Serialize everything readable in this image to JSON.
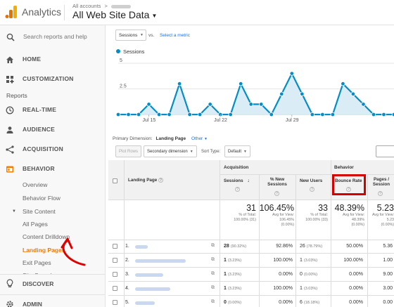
{
  "header": {
    "app_name": "Analytics",
    "crumb_prefix": "All accounts",
    "crumb_sep": ">",
    "view_name": "All Web Site Data"
  },
  "sidebar": {
    "search_placeholder": "Search reports and help",
    "home": "HOME",
    "customization": "CUSTOMIZATION",
    "reports_label": "Reports",
    "realtime": "REAL-TIME",
    "audience": "AUDIENCE",
    "acquisition": "ACQUISITION",
    "behavior": "BEHAVIOR",
    "behavior_items": {
      "overview": "Overview",
      "behavior_flow": "Behavior Flow",
      "site_content": "Site Content",
      "all_pages": "All Pages",
      "content_drilldown": "Content Drilldown",
      "landing_pages": "Landing Pages",
      "exit_pages": "Exit Pages",
      "site_speed": "Site Speed"
    },
    "discover": "DISCOVER",
    "admin": "ADMIN",
    "accent_color": "#f57c00"
  },
  "explorer": {
    "metric": "Sessions",
    "vs": "vs.",
    "select_metric": "Select a metric",
    "legend": "Sessions"
  },
  "chart_data": {
    "type": "line",
    "ylim": [
      0,
      5
    ],
    "yticks": [
      "5",
      "2.5"
    ],
    "xticks": [
      "Jul 15",
      "Jul 22",
      "Jul 29"
    ],
    "series": [
      {
        "name": "Sessions",
        "color": "#058dc7",
        "values": [
          0,
          0,
          0,
          1,
          0,
          0,
          3,
          0,
          0,
          1,
          0,
          0,
          3,
          1,
          1,
          0,
          2,
          4,
          2,
          0,
          0,
          0,
          3,
          2,
          1,
          0,
          0,
          0
        ]
      }
    ]
  },
  "dimension": {
    "label": "Primary Dimension:",
    "current": "Landing Page",
    "other": "Other"
  },
  "toolbar": {
    "plot_rows": "Plot Rows",
    "secondary_dim": "Secondary dimension",
    "sort_type_label": "Sort Type:",
    "sort_default": "Default"
  },
  "table": {
    "group_acquisition": "Acquisition",
    "group_behavior": "Behavior",
    "col_landing": "Landing Page",
    "col_sessions": "Sessions",
    "col_new_sessions_1": "% New",
    "col_new_sessions_2": "Sessions",
    "col_new_users": "New Users",
    "col_bounce": "Bounce Rate",
    "col_pages_1": "Pages /",
    "col_pages_2": "Session",
    "totals": {
      "sessions": "31",
      "sessions_sub1": "% of Total:",
      "sessions_sub2": "100.00% (31)",
      "new_sessions": "106.45%",
      "new_sessions_sub1": "Avg for View:",
      "new_sessions_sub2": "106.45%",
      "new_sessions_sub3": "(0.00%)",
      "new_users": "33",
      "new_users_sub1": "% of Total:",
      "new_users_sub2": "100.00% (33)",
      "bounce": "48.39%",
      "bounce_sub1": "Avg for View:",
      "bounce_sub2": "48.39%",
      "bounce_sub3": "(0.00%)",
      "pages": "5.23",
      "pages_sub1": "Avg for View:",
      "pages_sub2": "5.23",
      "pages_sub3": "(0.00%)"
    },
    "rows": [
      {
        "idx": "1.",
        "sessions": "28",
        "sessions_pct": "(90.32%)",
        "new_sessions": "92.86%",
        "new_users": "26",
        "new_users_pct": "(78.79%)",
        "bounce": "50.00%",
        "pages": "5.36"
      },
      {
        "idx": "2.",
        "sessions": "1",
        "sessions_pct": "(3.23%)",
        "new_sessions": "100.00%",
        "new_users": "1",
        "new_users_pct": "(3.03%)",
        "bounce": "100.00%",
        "pages": "1.00"
      },
      {
        "idx": "3.",
        "sessions": "1",
        "sessions_pct": "(3.23%)",
        "new_sessions": "0.00%",
        "new_users": "0",
        "new_users_pct": "(0.00%)",
        "bounce": "0.00%",
        "pages": "9.00"
      },
      {
        "idx": "4.",
        "sessions": "1",
        "sessions_pct": "(3.23%)",
        "new_sessions": "100.00%",
        "new_users": "1",
        "new_users_pct": "(3.03%)",
        "bounce": "0.00%",
        "pages": "3.00"
      },
      {
        "idx": "5.",
        "sessions": "0",
        "sessions_pct": "(0.00%)",
        "new_sessions": "0.00%",
        "new_users": "6",
        "new_users_pct": "(18.18%)",
        "bounce": "0.00%",
        "pages": "0.00"
      }
    ]
  }
}
